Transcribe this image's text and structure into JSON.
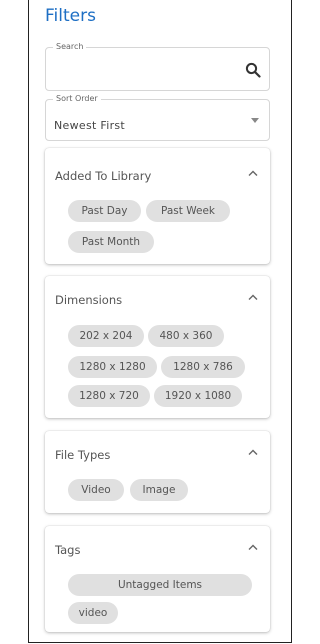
{
  "filters": {
    "title": "Filters",
    "search": {
      "label": "Search",
      "value": ""
    },
    "sort": {
      "label": "Sort Order",
      "value": "Newest First"
    },
    "sections": [
      {
        "title": "Added To Library",
        "expanded": true,
        "chips": [
          "Past Day",
          "Past Week",
          "Past Month"
        ]
      },
      {
        "title": "Dimensions",
        "expanded": true,
        "chips": [
          "202 x 204",
          "480 x 360",
          "1280 x 1280",
          "1280 x 786",
          "1280 x 720",
          "1920 x 1080"
        ]
      },
      {
        "title": "File Types",
        "expanded": true,
        "chips": [
          "Video",
          "Image"
        ]
      },
      {
        "title": "Tags",
        "expanded": true,
        "chips": [
          "Untagged Items",
          "video"
        ]
      }
    ]
  },
  "colors": {
    "accent": "#1e6fc4",
    "chip_bg": "#e0e0e0"
  },
  "icons": {
    "search": "search-icon",
    "expand": "chevron-up-icon",
    "dropdown": "caret-down-icon"
  }
}
